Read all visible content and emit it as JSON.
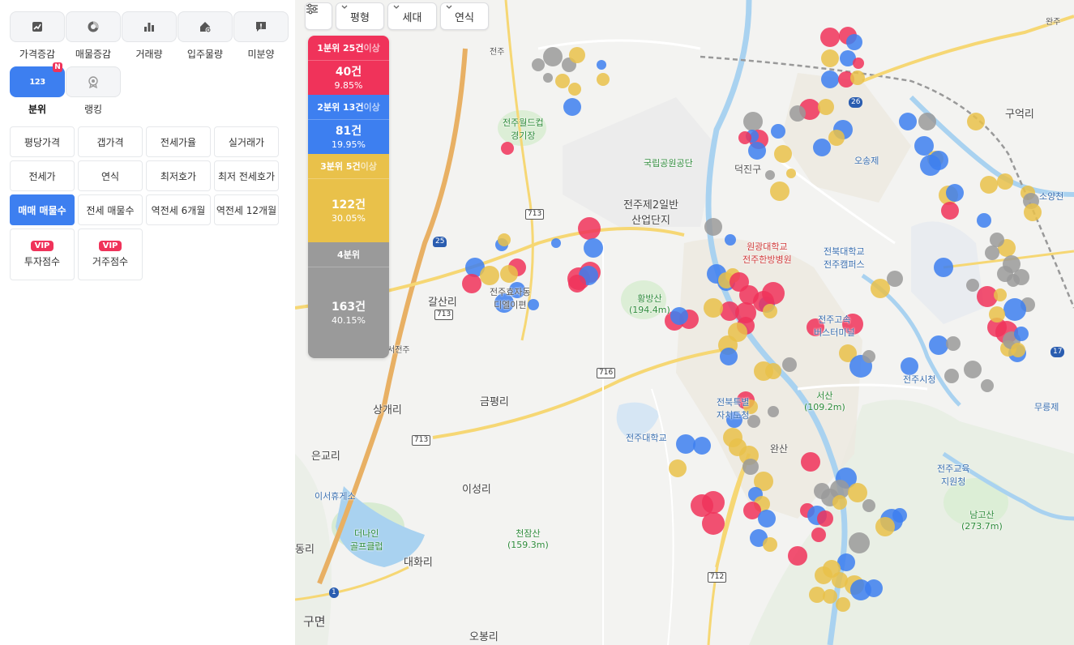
{
  "categories": [
    {
      "label": "가격증감",
      "icon": "trend-chart-icon"
    },
    {
      "label": "매물증감",
      "icon": "pie-chart-icon"
    },
    {
      "label": "거래량",
      "icon": "bar-chart-icon"
    },
    {
      "label": "입주물량",
      "icon": "house-plus-icon"
    },
    {
      "label": "미분양",
      "icon": "alert-message-icon"
    },
    {
      "label": "분위",
      "icon": "quantile-icon",
      "icon_text": "123",
      "badge": "N"
    },
    {
      "label": "랭킹",
      "icon": "medal-icon"
    }
  ],
  "options": {
    "row1": [
      "평당가격",
      "갭가격",
      "전세가율",
      "실거래가"
    ],
    "row2": [
      "전세가",
      "연식",
      "최저호가",
      "최저 전세호가"
    ],
    "row3": [
      "매매 매물수",
      "전세 매물수",
      "역전세 6개월",
      "역전세 12개월"
    ],
    "selected": "매매 매물수",
    "vip_badge": "VIP",
    "vip": [
      "투자점수",
      "거주점수"
    ]
  },
  "map_controls": {
    "filter_icon": "sliders-icon",
    "dropdowns": [
      "평형",
      "세대",
      "연식"
    ]
  },
  "legend": [
    {
      "title": "1분위 25건",
      "suffix": "이상",
      "count": "40건",
      "pct": "9.85%",
      "color": "#f0335a"
    },
    {
      "title": "2분위 13건",
      "suffix": "이상",
      "count": "81건",
      "pct": "19.95%",
      "color": "#3d7ff0"
    },
    {
      "title": "3분위 5건",
      "suffix": "이상",
      "count": "122건",
      "pct": "30.05%",
      "color": "#e9c14a"
    },
    {
      "title": "4분위",
      "suffix": "",
      "count": "163건",
      "pct": "40.15%",
      "color": "#9a9a9a"
    }
  ],
  "map_labels": {
    "jeonju_worldcup": "전주월드컵\n경기장",
    "kukrip": "국립공원공단",
    "industrial": "전주제2일반\n산업단지",
    "deokjin": "덕진구",
    "wonkwang": "원광대학교\n전주한방병원",
    "chonbuk": "전북대학교\n전주캠퍼스",
    "hwangbang": "황방산\n(194.4m)",
    "galsanri": "갈산리",
    "jeonju_terminal": "전주고속\n버스터미널",
    "jeonju_city": "전주시청",
    "geumpyeongri": "금평리",
    "sanggaeri": "상개리",
    "jeonbuk_office": "전북특별\n자치도청",
    "seosan": "서산\n(109.2m)",
    "jeonju_univ": "전주대학교",
    "wansan": "완산",
    "eungoeri": "은교리",
    "iseo_rest": "이서휴게소",
    "ise_ongri": "이성리",
    "deoneine": "더나인\n골프클럽",
    "cheonjamsan": "천잠산\n(159.3m)",
    "daehwari": "대화리",
    "gumyeon": "구면",
    "obongri": "오봉리",
    "namgosan": "남고산\n(273.7m)",
    "jeonju_edu": "전주교육\n지원청",
    "guokri": "구억리",
    "sojangcheon": "소양천",
    "museungje": "무릉제",
    "jeonju_ic": "전주",
    "wanju": "완주",
    "osongje": "오송제",
    "hyoja": "전주효자동\n디엘이편",
    "dongri": "동리",
    "seojeonju": "서전주"
  },
  "road_numbers": [
    "713",
    "716",
    "713",
    "713",
    "712",
    "25",
    "26",
    "17",
    "1"
  ]
}
